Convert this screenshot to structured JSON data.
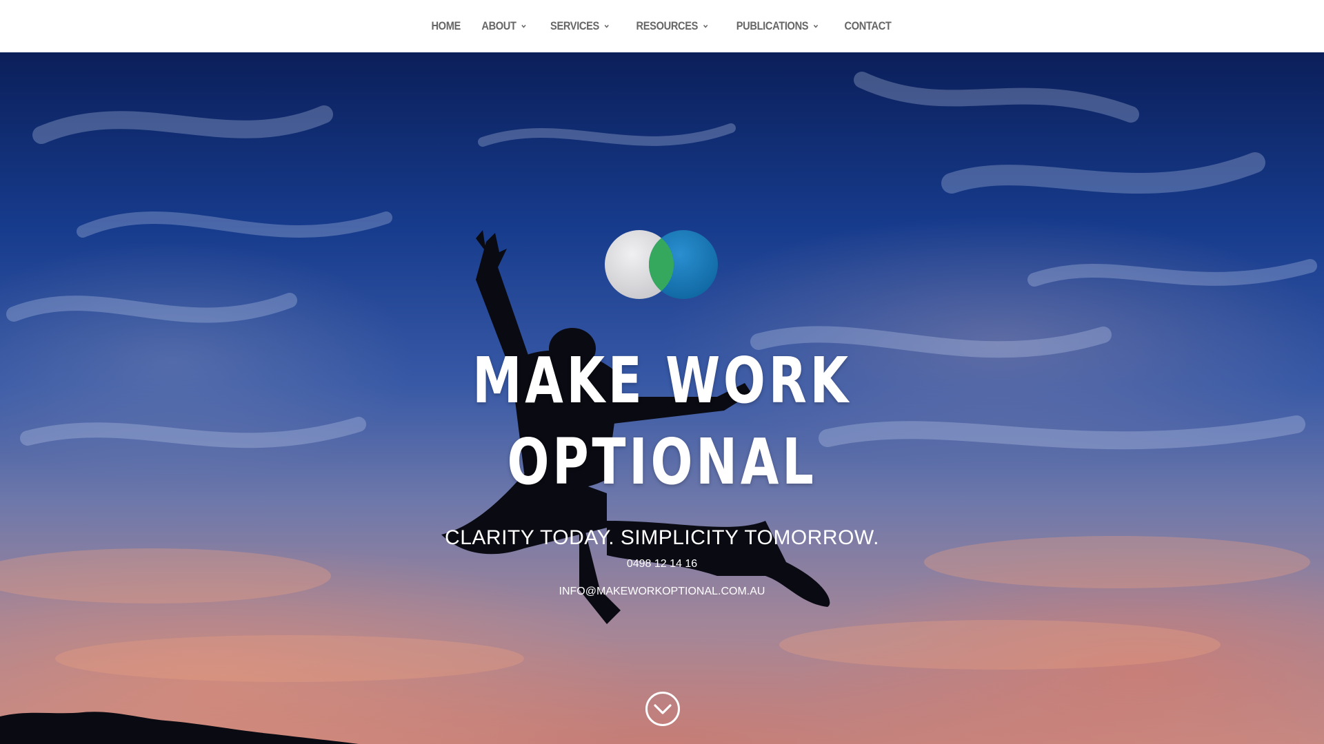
{
  "nav": {
    "items": [
      {
        "label": "HOME",
        "has_dropdown": false
      },
      {
        "label": "ABOUT",
        "has_dropdown": true
      },
      {
        "label": "SERVICES",
        "has_dropdown": true
      },
      {
        "label": "RESOURCES",
        "has_dropdown": true
      },
      {
        "label": "PUBLICATIONS",
        "has_dropdown": true
      },
      {
        "label": "CONTACT",
        "has_dropdown": false
      }
    ]
  },
  "hero": {
    "title_line1": "MAKE WORK",
    "title_line2": "OPTIONAL",
    "tagline": "CLARITY TODAY. SIMPLICITY TOMORROW.",
    "phone": "0498 12 14 16",
    "email": "INFO@MAKEWORKOPTIONAL.COM.AU",
    "background_image": "silhouette of person jumping against sunset sky",
    "scroll_icon": "chevron-down-circle-icon"
  },
  "colors": {
    "nav_text": "#666666",
    "nav_bg": "#ffffff",
    "logo_left": "#d9d9dc",
    "logo_right": "#1778b3",
    "logo_overlap": "#35a85e",
    "hero_text": "#ffffff"
  }
}
